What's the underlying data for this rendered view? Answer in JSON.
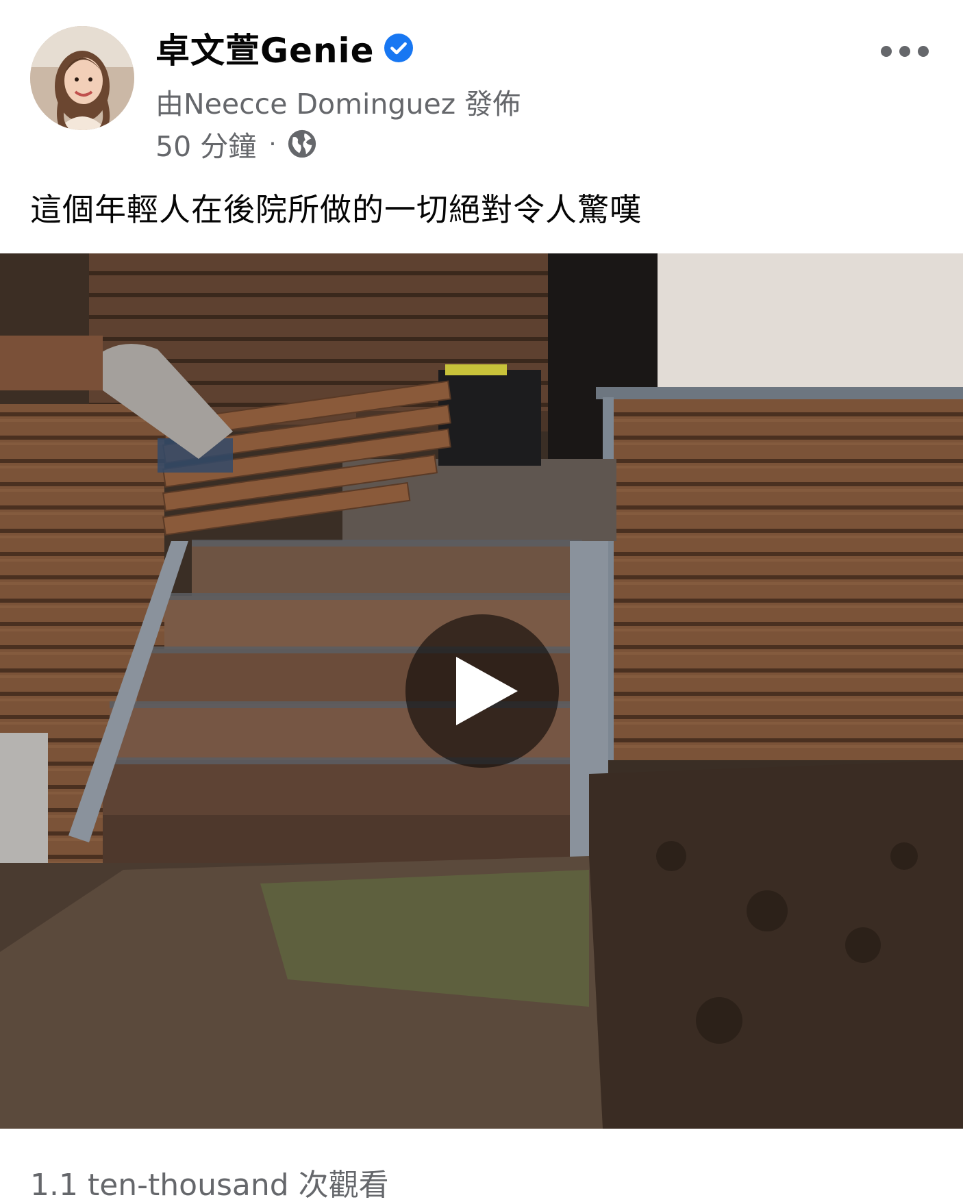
{
  "post": {
    "page_name": "卓文萱Genie",
    "posted_by": "由Neecce Dominguez 發佈",
    "time": "50 分鐘",
    "meta_separator": "·",
    "caption": "這個年輕人在後院所做的一切絕對令人驚嘆",
    "views": "1.1 ten-thousand 次觀看"
  },
  "icons": {
    "verified": "verified-badge-icon",
    "audience": "globe-icon",
    "more": "more-options-icon",
    "play": "play-icon"
  },
  "colors": {
    "verified_blue": "#1877f2",
    "secondary_text": "#65676b",
    "primary_text": "#050505"
  }
}
